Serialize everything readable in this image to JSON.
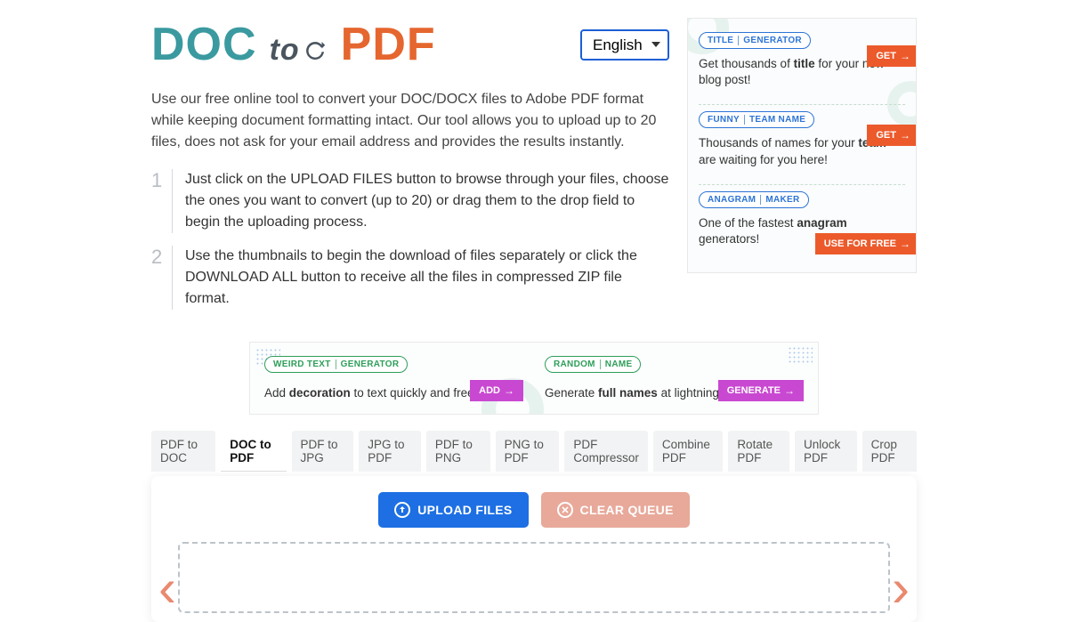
{
  "logo": {
    "doc": "DOC",
    "to": "to",
    "pdf": "PDF"
  },
  "language": {
    "selected": "English"
  },
  "intro": "Use our free online tool to convert your DOC/DOCX files to Adobe PDF format while keeping document formatting intact. Our tool allows you to upload up to 20 files, does not ask for your email address and provides the results instantly.",
  "steps": [
    {
      "num": "1",
      "text": "Just click on the UPLOAD FILES button to browse through your files, choose the ones you want to convert (up to 20) or drag them to the drop field to begin the uploading process."
    },
    {
      "num": "2",
      "text": "Use the thumbnails to begin the download of files separately or click the DOWNLOAD ALL button to receive all the files in compressed ZIP file format."
    }
  ],
  "sidebar_ads": [
    {
      "pill_a": "TITLE",
      "pill_b": "GENERATOR",
      "pill_color": "blue",
      "text_pre": "Get thousands of ",
      "text_bold": "title",
      "text_post": " for your new blog post!",
      "cta": "GET"
    },
    {
      "pill_a": "FUNNY",
      "pill_b": "TEAM NAME",
      "pill_color": "blue",
      "text_pre": "Thousands of names for your ",
      "text_bold": "team",
      "text_post": " are waiting for you here!",
      "cta": "GET"
    },
    {
      "pill_a": "ANAGRAM",
      "pill_b": "MAKER",
      "pill_color": "blue",
      "text_pre": "One of the fastest ",
      "text_bold": "anagram",
      "text_post": " generators!",
      "cta": "USE FOR FREE"
    }
  ],
  "mid_ads": [
    {
      "pill_a": "WEIRD TEXT",
      "pill_b": "GENERATOR",
      "text_pre": "Add ",
      "text_bold": "decoration",
      "text_post": " to text quickly and free!",
      "cta": "ADD"
    },
    {
      "pill_a": "RANDOM",
      "pill_b": "NAME",
      "text_pre": "Generate ",
      "text_bold": "full names",
      "text_post": " at lightning speed!",
      "cta": "GENERATE"
    }
  ],
  "tabs": [
    "PDF to DOC",
    "DOC to PDF",
    "PDF to JPG",
    "JPG to PDF",
    "PDF to PNG",
    "PNG to PDF",
    "PDF Compressor",
    "Combine PDF",
    "Rotate PDF",
    "Unlock PDF",
    "Crop PDF"
  ],
  "active_tab_index": 1,
  "buttons": {
    "upload": "UPLOAD FILES",
    "clear": "CLEAR QUEUE"
  }
}
